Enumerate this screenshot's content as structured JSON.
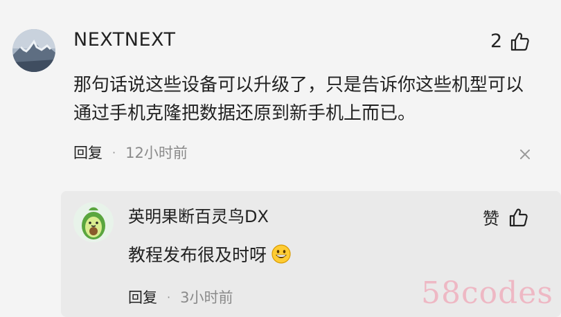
{
  "main_comment": {
    "username": "NEXTNEXT",
    "like_count": "2",
    "text": "那句话说这些设备可以升级了，只是告诉你这些机型可以通过手机克隆把数据还原到新手机上而已。",
    "reply_label": "回复",
    "separator": "·",
    "time": "12小时前"
  },
  "reply_comment": {
    "username": "英明果断百灵鸟DX",
    "like_label": "赞",
    "text": "教程发布很及时呀",
    "reply_label": "回复",
    "separator": "·",
    "time": "3小时前"
  },
  "watermark": "58codes",
  "icons": {
    "like": "thumbs-up-icon",
    "close": "close-icon",
    "emoji": "grinning-face-icon"
  }
}
